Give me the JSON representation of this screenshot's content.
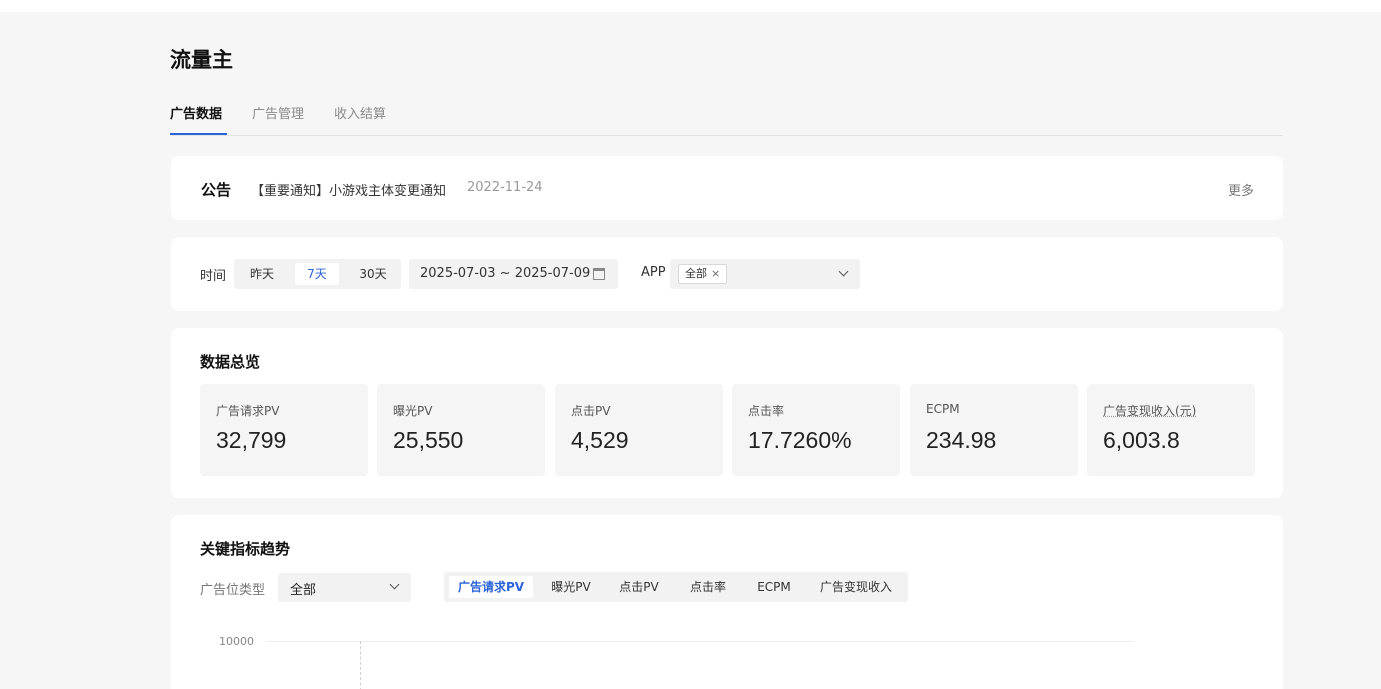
{
  "page": {
    "title": "流量主"
  },
  "tabs": [
    {
      "label": "广告数据",
      "active": true
    },
    {
      "label": "广告管理",
      "active": false
    },
    {
      "label": "收入结算",
      "active": false
    }
  ],
  "notice": {
    "title": "公告",
    "text": "【重要通知】小游戏主体变更通知",
    "date": "2022-11-24",
    "more": "更多"
  },
  "filters": {
    "time_label": "时间",
    "time_options": [
      {
        "label": "昨天",
        "active": false
      },
      {
        "label": "7天",
        "active": true
      },
      {
        "label": "30天",
        "active": false
      }
    ],
    "date_range": "2025-07-03 ~ 2025-07-09",
    "app_label": "APP",
    "app_tag": "全部",
    "app_tag_close": "×"
  },
  "overview": {
    "title": "数据总览",
    "metrics": [
      {
        "label": "广告请求PV",
        "value": "32,799"
      },
      {
        "label": "曝光PV",
        "value": "25,550"
      },
      {
        "label": "点击PV",
        "value": "4,529"
      },
      {
        "label": "点击率",
        "value": "17.7260%"
      },
      {
        "label": "ECPM",
        "value": "234.98"
      },
      {
        "label": "广告变现收入(元)",
        "value": "6,003.8"
      }
    ]
  },
  "trend": {
    "title": "关键指标趋势",
    "ad_position_label": "广告位类型",
    "ad_position_value": "全部",
    "metric_tabs": [
      {
        "label": "广告请求PV",
        "active": true
      },
      {
        "label": "曝光PV",
        "active": false
      },
      {
        "label": "点击PV",
        "active": false
      },
      {
        "label": "点击率",
        "active": false
      },
      {
        "label": "ECPM",
        "active": false
      },
      {
        "label": "广告变现收入",
        "active": false
      }
    ],
    "y_tick_top": "10000"
  },
  "colors": {
    "accent": "#2b63d9",
    "background": "#f6f6f6",
    "card": "#ffffff"
  }
}
